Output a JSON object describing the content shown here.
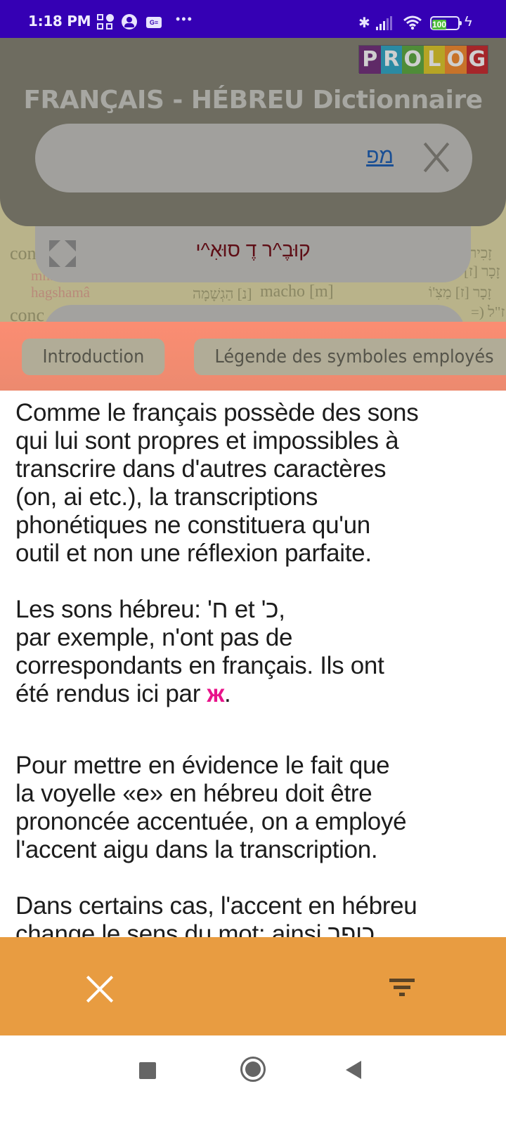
{
  "status_bar": {
    "time": "1:18 PM",
    "battery_level": "100",
    "icons": [
      "apps-icon",
      "account-icon",
      "card-icon",
      "more-dots-icon",
      "bluetooth-icon",
      "signal-icon",
      "wifi-icon",
      "battery-icon",
      "charging-icon"
    ]
  },
  "header": {
    "logo_letters": [
      "P",
      "R",
      "O",
      "L",
      "O",
      "G"
    ],
    "logo_colors": [
      "#5f2a67",
      "#2b8aa3",
      "#4f8c38",
      "#b6a425",
      "#c7732a",
      "#a5262a"
    ],
    "title": "FRANÇAIS - HÉBREU Dictionnaire"
  },
  "search": {
    "value_link": "מפ",
    "clear_icon": "close-icon"
  },
  "result": {
    "word": "קוּבֶ^ר דֶ סוּאִ^י",
    "expand_icon": "expand-icon"
  },
  "dictionary_background": {
    "lines": [
      {
        "text": "con",
        "color": "#8a8764"
      },
      {
        "text": "mm",
        "color": "#b98a7a"
      },
      {
        "text": "hagshamâ",
        "color": "#b98a7a"
      },
      {
        "text": "[נ] הַגְשָׁמָה",
        "color": "#8a8764"
      },
      {
        "text": "macho [m]",
        "color": "#8a8764"
      },
      {
        "text": "זָכִיר",
        "color": "#8a8764"
      },
      {
        "text": "זָכָר [ז]",
        "color": "#8a8764"
      },
      {
        "text": "זָכָר [ז] מַצִ'וֹ",
        "color": "#8a8764"
      },
      {
        "text": "ז\"ל (=",
        "color": "#8a8764"
      },
      {
        "text": "conc",
        "color": "#8a8764"
      }
    ]
  },
  "chips": [
    {
      "label": "Introduction"
    },
    {
      "label": "Légende des symboles employés"
    }
  ],
  "content": {
    "paragraphs": [
      {
        "text": "Comme le français possède des sons\nqui lui sont propres et impossibles à\ntranscrire dans d'autres caractères\n(on, ai etc.), la transcriptions\nphonétiques ne constituera qu'un\noutil et non une réflexion parfaite."
      },
      {
        "text_before": "Les sons hébreu: 'ח et 'כ,\npar exemple, n'ont pas de\ncorrespondants en français. Ils ont\nété rendus ici par ",
        "mark": "ж",
        "text_after": "."
      },
      {
        "text": "Pour mettre en évidence le fait que\nla voyelle «e» en hébreu doit être\nprononcée accentuée, on a employé\nl'accent aigu dans la transcription."
      },
      {
        "text": "Dans certains cas, l'accent en hébreu\nchange le sens du mot: ainsi כופר"
      }
    ],
    "mark_color": "#e8138a"
  },
  "action_bar": {
    "close_icon": "close-icon",
    "filter_icon": "filter-icon",
    "background": "#e89c41"
  },
  "nav_bar": {
    "buttons": [
      "recents-icon",
      "home-icon",
      "back-icon"
    ]
  }
}
